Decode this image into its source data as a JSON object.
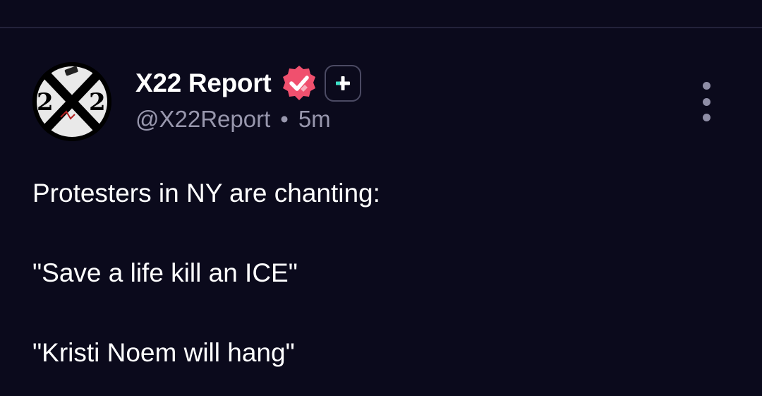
{
  "post": {
    "author": {
      "display_name": "X22 Report",
      "handle": "@X22Report",
      "avatar_text": "2X2",
      "verified_icon": "verified-check-icon",
      "plus_icon": "plus-icon"
    },
    "separator": "•",
    "timestamp": "5m",
    "more_icon": "more-vertical-icon",
    "body": {
      "line1": "Protesters in NY are chanting:",
      "line2": "\"Save a life kill an ICE\"",
      "line3": "\"Kristi Noem will hang\""
    }
  },
  "colors": {
    "background": "#0b0a1c",
    "divider": "#23223a",
    "verified": "#f0506e",
    "plus_accent": "#3ee0c8",
    "secondary_text": "#9897ad"
  }
}
